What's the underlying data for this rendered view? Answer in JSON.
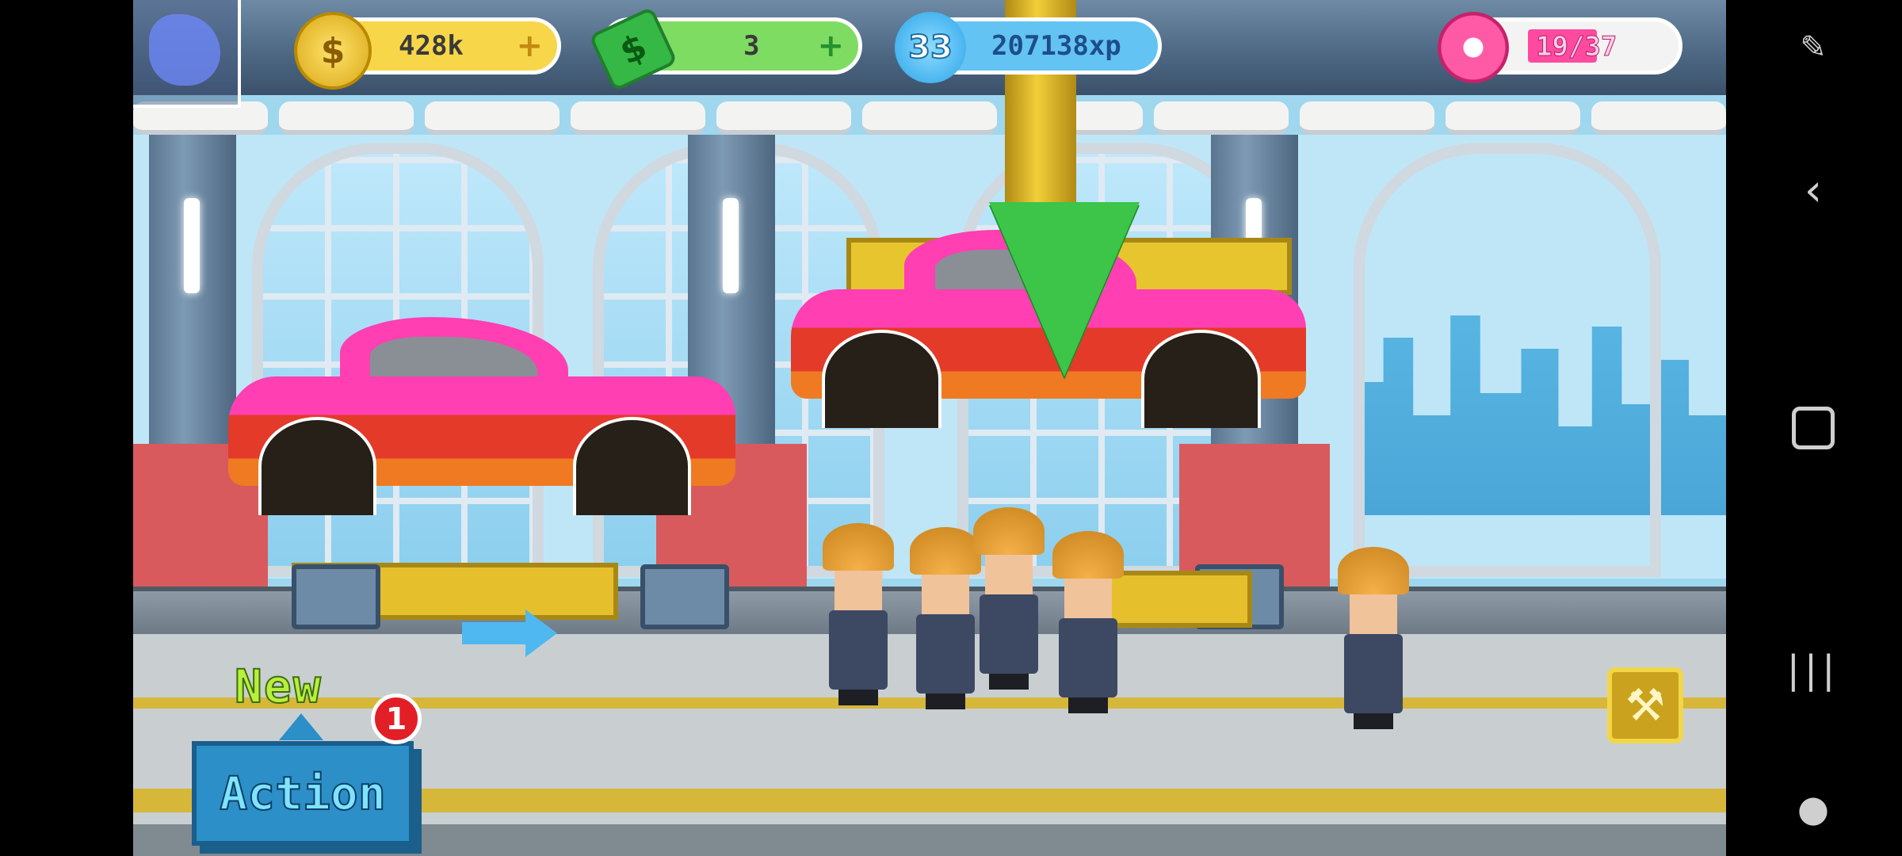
{
  "hud": {
    "coins": "428k",
    "coins_plus": "+",
    "cash": "3",
    "cash_plus": "+",
    "level": "33",
    "xp": "207138xp",
    "donuts": "19/37",
    "donut_fill": 0.51
  },
  "action": {
    "new_label": "New",
    "button_label": "Action",
    "badge_count": "1"
  },
  "icons": {
    "coin": "dollar-coin-icon",
    "cash": "cash-bill-icon",
    "xp": "xp-star-icon",
    "donut": "donut-icon",
    "wrench": "wrench-icon",
    "back": "back-chevron-icon",
    "home": "home-square-icon",
    "recents": "recents-lines-icon"
  },
  "colors": {
    "car_body": "#ff3fb2",
    "coin_bar": "#f7d64a",
    "cash_bar": "#7fdc62",
    "xp_bar": "#63c3f3",
    "action_button": "#2c8fc7"
  }
}
